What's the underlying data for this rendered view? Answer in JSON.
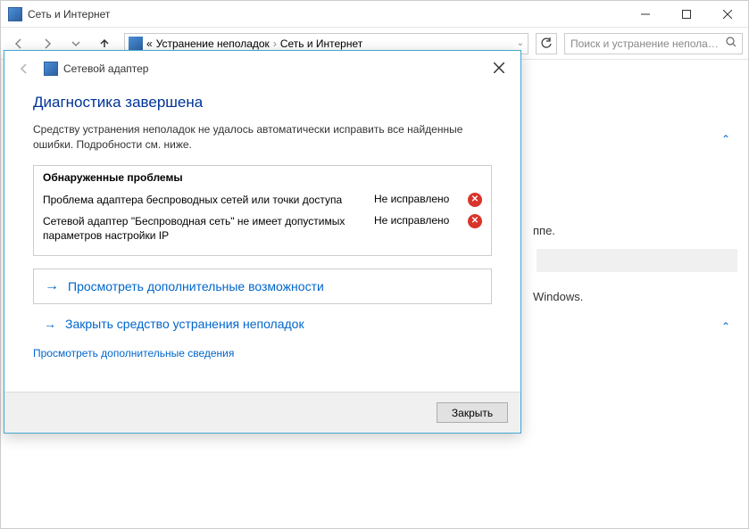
{
  "parent_window": {
    "title": "Сеть и Интернет",
    "breadcrumb_prefix": "«",
    "breadcrumb": [
      "Устранение неполадок",
      "Сеть и Интернет"
    ],
    "search_placeholder": "Поиск и устранение неполад...",
    "bg_text1": "ппе.",
    "bg_text2": "Windows."
  },
  "dialog": {
    "title": "Сетевой адаптер",
    "heading": "Диагностика завершена",
    "description": "Средству устранения неполадок не удалось автоматически исправить все найденные ошибки. Подробности см. ниже.",
    "problems_header": "Обнаруженные проблемы",
    "problems": [
      {
        "desc": "Проблема адаптера беспроводных сетей или точки доступа",
        "status": "Не исправлено"
      },
      {
        "desc": "Сетевой адаптер \"Беспроводная сеть\" не имеет допустимых параметров настройки IP",
        "status": "Не исправлено"
      }
    ],
    "action_more": "Просмотреть дополнительные возможности",
    "action_close": "Закрыть средство устранения неполадок",
    "details_link": "Просмотреть дополнительные сведения",
    "close_button": "Закрыть"
  }
}
